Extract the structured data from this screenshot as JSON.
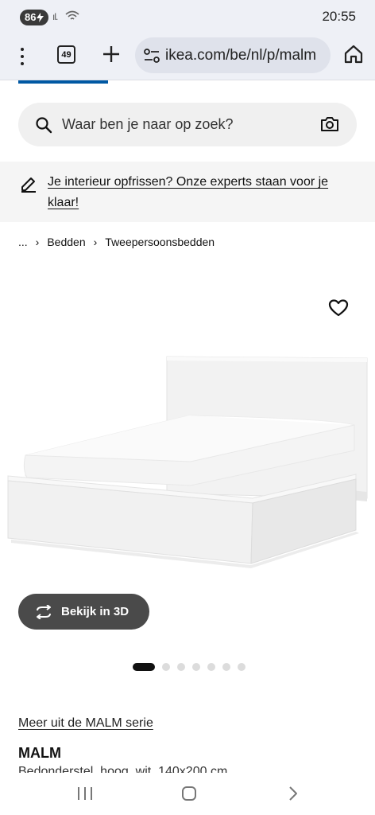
{
  "status_bar": {
    "battery": "86",
    "time": "20:55"
  },
  "browser": {
    "tab_count": "49",
    "url": "ikea.com/be/nl/p/malm"
  },
  "search": {
    "placeholder": "Waar ben je naar op zoek?"
  },
  "promo": {
    "text": "Je interieur opfrissen? Onze experts staan voor je klaar!"
  },
  "breadcrumb": {
    "items": [
      "...",
      "Bedden",
      "Tweepersoonsbedden"
    ]
  },
  "gallery": {
    "view_3d_label": "Bekijk in 3D",
    "dot_count": 7,
    "active_dot": 1
  },
  "product": {
    "series_link": "Meer uit de MALM serie",
    "name": "MALM",
    "description": "Bedonderstel, hoog, wit, 140x200 cm"
  },
  "icons": {
    "status": [
      "battery-icon",
      "signal-icon",
      "wifi-icon"
    ],
    "browser": [
      "menu-icon",
      "tabs-icon",
      "plus-icon",
      "site-settings-icon",
      "home-icon"
    ],
    "page": [
      "search-icon",
      "camera-icon",
      "pencil-icon",
      "chevron-right-icon",
      "heart-icon",
      "rotate-3d-icon"
    ],
    "nav": [
      "recent-apps-icon",
      "home-nav-icon",
      "back-icon"
    ]
  },
  "colors": {
    "ikea_blue": "#0058a3",
    "button_dark": "#4a4a4a",
    "browser_bar": "#eef0f6"
  }
}
